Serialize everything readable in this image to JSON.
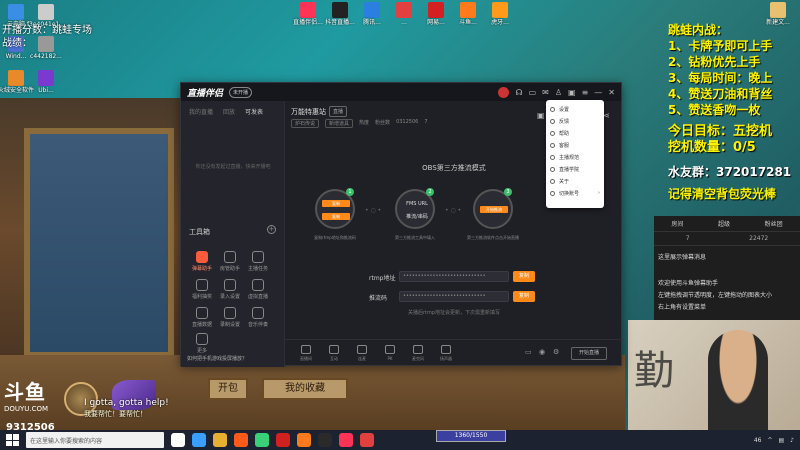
{
  "desktop": {
    "icons_top_left": [
      {
        "label": "云电脑",
        "color": "#3a8ee6"
      },
      {
        "label": "f3e4041e1...",
        "color": "#cccccc"
      }
    ],
    "icons_left": [
      {
        "label": "Wind...",
        "color": "#4a6fd0"
      },
      {
        "label": "c442182...",
        "color": "#999999"
      },
      {
        "label": "火绒安全软件",
        "color": "#e88a2a"
      },
      {
        "label": "Ubi...",
        "color": "#7a3ad0"
      }
    ],
    "icons_top": [
      {
        "label": "直播伴侣...",
        "color": "#ff3355"
      },
      {
        "label": "抖音直播...",
        "color": "#222222"
      },
      {
        "label": "腾讯...",
        "color": "#2a7fe0"
      },
      {
        "label": "...",
        "color": "#e24040"
      },
      {
        "label": "网易...",
        "color": "#d42020"
      },
      {
        "label": "斗鱼...",
        "color": "#ff7a1a"
      },
      {
        "label": "虎牙...",
        "color": "#ff9a1a"
      }
    ],
    "icon_top_right": {
      "label": "新建文...",
      "color": "#e8c070"
    },
    "overlay_left": [
      "开播分数：跳蛙专场",
      "战绩："
    ],
    "overlay_right": {
      "title": "跳蛙内战：",
      "lines": [
        "1、卡牌予即可上手",
        "2、钻粉优先上手",
        "3、每局时间：晚上",
        "4、赞送刀油和背丝",
        "5、赞送香吻一枚"
      ],
      "target": "今日目标：五挖机",
      "count": "挖机数量：0/5",
      "qq": "水友群：372017281",
      "note": "记得清空背包荧光棒"
    }
  },
  "app": {
    "title": "直播伴侣",
    "badge": "未开播",
    "side_tabs": [
      "我的直播",
      "回放",
      "可发表"
    ],
    "side_empty": "你还没有发起过直播，快来开播吧",
    "tools_title": "工具箱",
    "tools": [
      {
        "label": "弹幕助手",
        "hot": true
      },
      {
        "label": "房管助手",
        "hot": false
      },
      {
        "label": "主播任务",
        "hot": false
      },
      {
        "label": "福利抽奖",
        "hot": false
      },
      {
        "label": "录入设置",
        "hot": false
      },
      {
        "label": "虚拟直播",
        "hot": false
      },
      {
        "label": "直播数据",
        "hot": false
      },
      {
        "label": "录制设置",
        "hot": false
      },
      {
        "label": "音乐伴奏",
        "hot": false
      },
      {
        "label": "更多",
        "hot": false
      }
    ],
    "notice": "如何把手机游戏投屏播放？",
    "room_title": "万能特惠站",
    "room_tag": "直播",
    "meta": [
      "炉石传说",
      "新增道具",
      "热度",
      "粉丝数",
      "0312506",
      "7"
    ],
    "mode_title": "OBS第三方推流模式",
    "steps": [
      {
        "num": "1",
        "top": "复制",
        "bottom": "复制",
        "desc": "复制rtmp地址和推流码"
      },
      {
        "num": "2",
        "top": "FMS URL",
        "bottom": "推流/串码",
        "desc": "第三方推流工具中填入"
      },
      {
        "num": "3",
        "top": "开始推流",
        "bottom": "",
        "desc": "第三方推流软件点击开始直播"
      }
    ],
    "rtmp_label": "rtmp地址",
    "rtmp_value": "••••••••••••••••••••••••••••",
    "key_label": "推流码",
    "key_value": "••••••••••••••••••••••••••••",
    "copy_label": "复制",
    "hint": "关播后rtmp地址会更新，下次需重新填写",
    "bottom_buttons": [
      "直播间",
      "互动",
      "连麦",
      "PK",
      "麦克风",
      "扬声器"
    ],
    "start_label": "开始直播"
  },
  "menu": {
    "items": [
      {
        "label": "设置",
        "arrow": false
      },
      {
        "label": "反馈",
        "arrow": false
      },
      {
        "label": "帮助",
        "arrow": false
      },
      {
        "label": "客服",
        "arrow": false
      },
      {
        "label": "主播规范",
        "arrow": false
      },
      {
        "label": "直播学院",
        "arrow": false
      },
      {
        "label": "关于",
        "arrow": false
      },
      {
        "label": "切换账号",
        "arrow": true
      }
    ]
  },
  "game": {
    "btn1": "开包",
    "btn2": "我的收藏",
    "douyu_logo": "斗鱼",
    "douyu_sub": "DOUYU.COM",
    "room_id": "9312506",
    "bubble1": "I gotta, gotta help!",
    "bubble2": "我要帮忙！要帮忙！",
    "hp": "1360/1550"
  },
  "chat": {
    "header": [
      "房间",
      "超级",
      "粉丝团"
    ],
    "stats": [
      "7",
      "22472"
    ],
    "lines": [
      "欢迎使用斗鱼弹幕助手",
      "左键拖拽调节透明度，左键拖动的图表大小",
      "右上角有设置菜单"
    ],
    "line_top": "这里展示弹幕消息"
  },
  "taskbar": {
    "search_placeholder": "在这里输入你要搜索的内容",
    "icons": [
      "#ffffff",
      "#3aa0ff",
      "#e8b030",
      "#ff5a1a",
      "#3ad07a",
      "#d02020",
      "#ff7a1a",
      "#2a2a2a",
      "#ff3355",
      "#e04040"
    ],
    "right_text": "46"
  }
}
